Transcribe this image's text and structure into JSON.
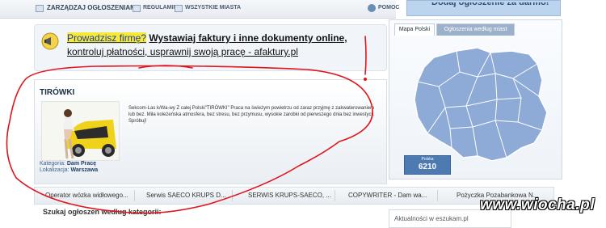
{
  "nav": {
    "manage_label": "ZARZĄDZAJ OGŁOSZENIAMI",
    "rules_label": "REGULAMIN",
    "all_cities_label": "WSZYSTKIE MIASTA",
    "help_label": "POMOC",
    "add_ad_label": "Dodaj ogłoszenie za darmo!"
  },
  "promo": {
    "question": "Prowadzisz firmę?",
    "headline": "Wystawiaj faktury i inne dokumenty online,",
    "subline": "kontroluj płatności, usprawnij swoją pracę - afaktury.pl"
  },
  "listing": {
    "title": "TIRÓWKI",
    "description": "Sekcom-Las k/Wa-wy Z całej Polski\"TIRÓWKI\" Praca na świeżym powietrzu od zaraz przyjmę z zakwaterowaniem lub bez. Miła koleżeńska atmosfera, bez stresu, bez przymusu, wysokie zarobki od pierwszego dnia bez inwestycji. Spróbuj!",
    "category_label": "Kategoria:",
    "category_value": "Dam Pracę",
    "location_label": "Lokalizacja:",
    "location_value": "Warszawa"
  },
  "map": {
    "tab_active": "Mapa Polski",
    "tab_inactive": "Ogłoszenia według miast",
    "count_label": "Polska",
    "count_value": "6210"
  },
  "categories": [
    "Operator wózka widłowego...",
    "Serwis SAECO KRUPS D...",
    "SERWIS KRUPS-SAECO, ...",
    "COPYWRITER - Dam wa...",
    "Pożyczka Pozabankowa N..."
  ],
  "search_by_category": "Szukaj ogłoszeń według kategorii:",
  "news_label": "Aktualności w eszukam.pl",
  "watermark": "www.wiocha.pl",
  "colors": {
    "accent_blue": "#4e7ab2",
    "map_fill": "#8eaad6",
    "scribble_red": "#e0141c"
  }
}
